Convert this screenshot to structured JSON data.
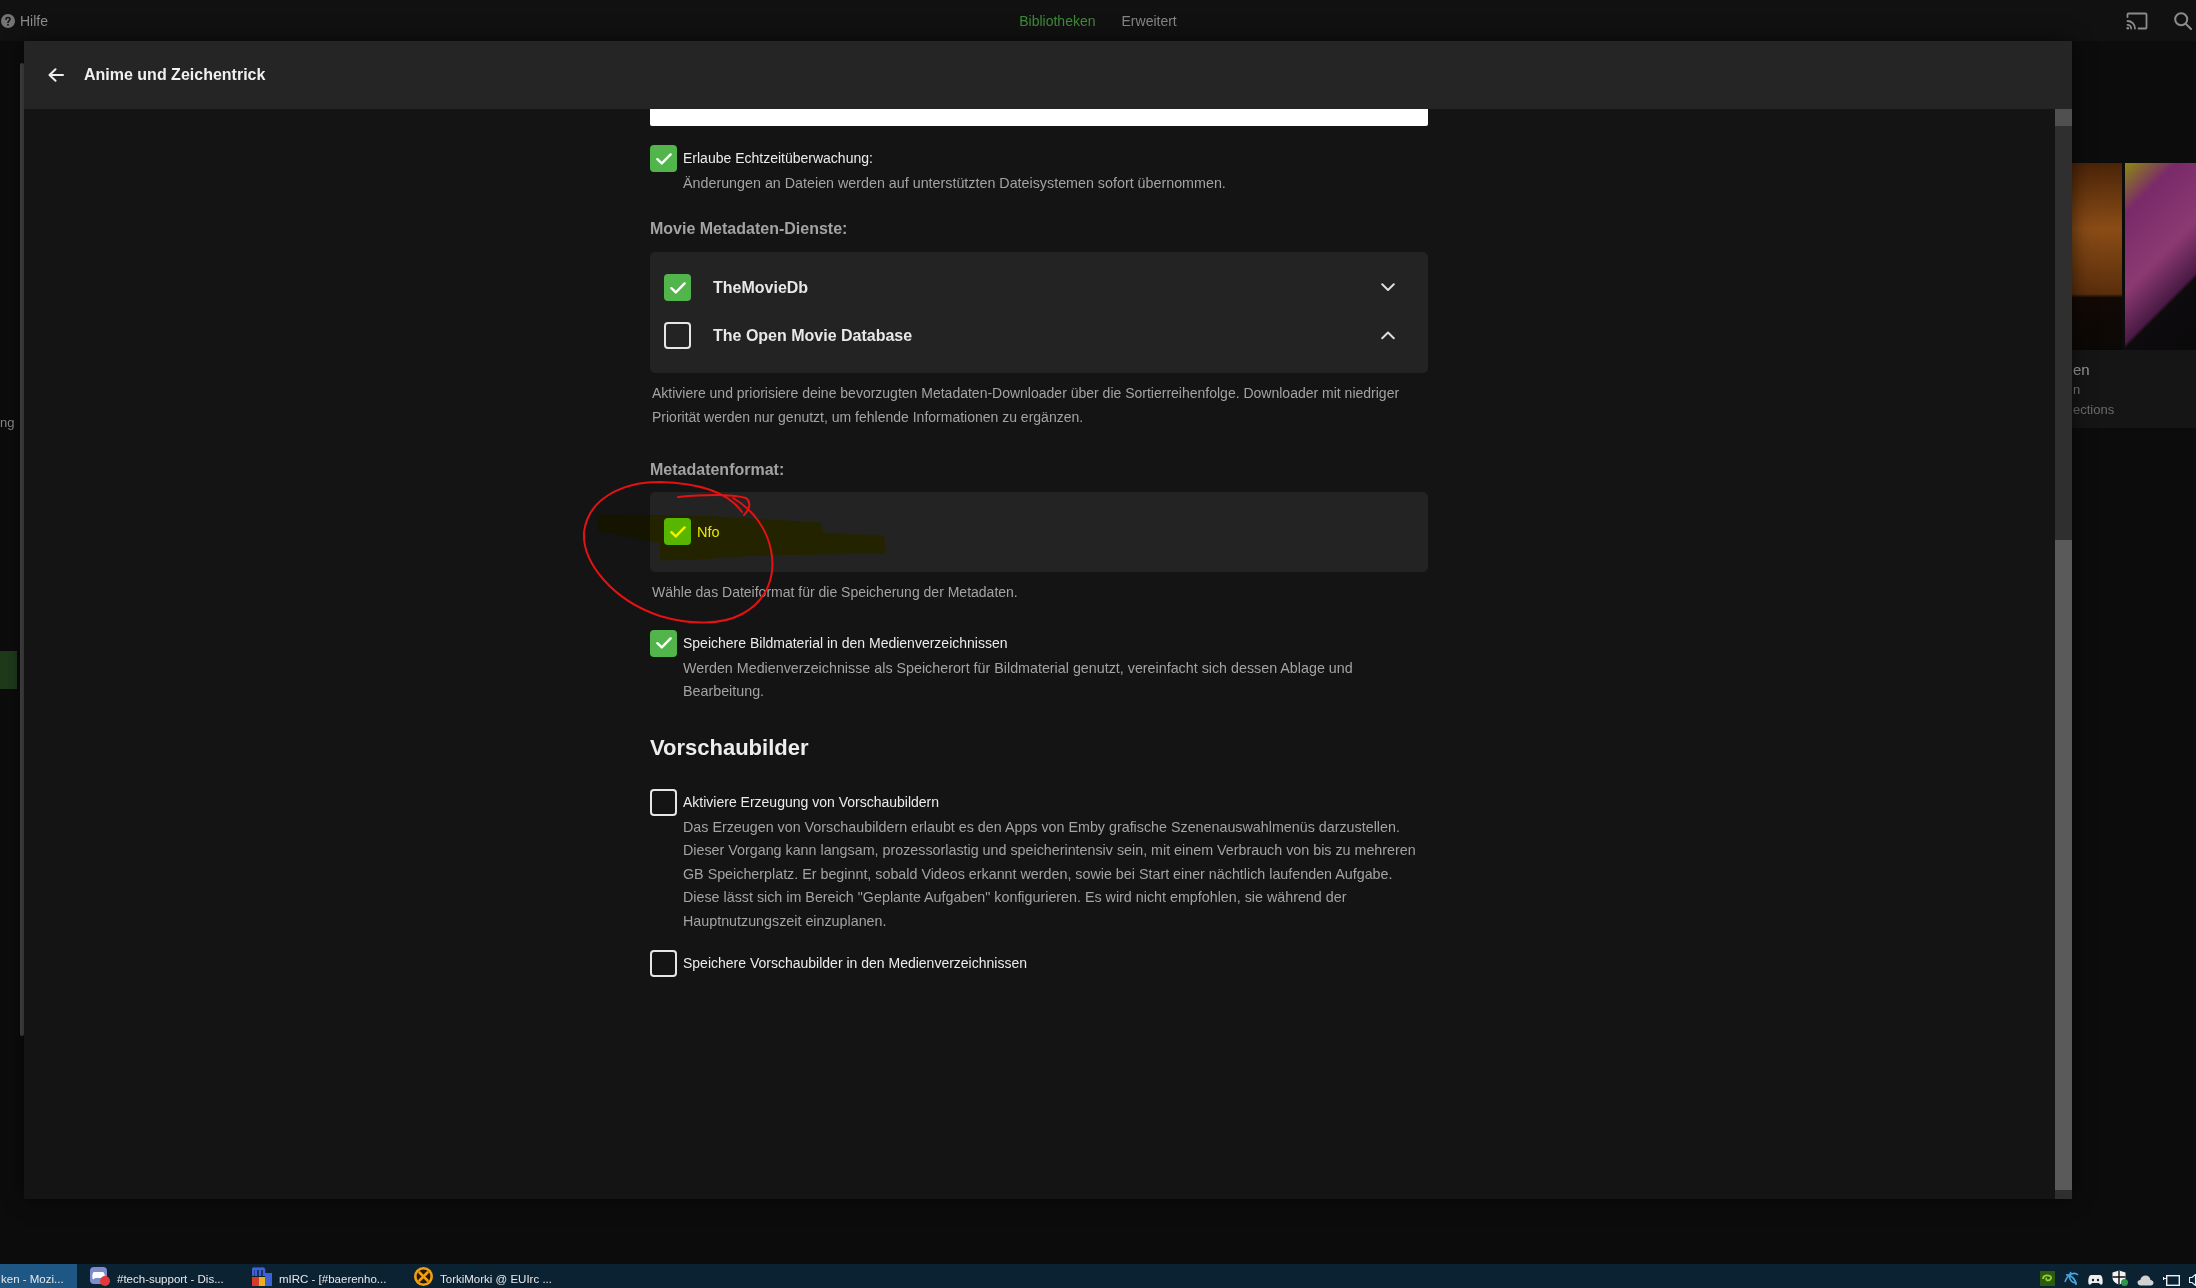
{
  "app_bar": {
    "help": "Hilfe",
    "tabs": [
      {
        "label": "Bibliotheken",
        "selected": true
      },
      {
        "label": "Erweitert",
        "selected": false
      }
    ]
  },
  "background_page": {
    "nav_items": [
      {
        "text": "ng",
        "selected": false
      },
      {
        "selected": true
      }
    ],
    "library_card_lines": [
      "en",
      "n",
      "ections"
    ]
  },
  "dialog": {
    "title": "Anime und Zeichentrick",
    "realtime_monitoring": {
      "label": "Erlaube Echtzeitüberwachung:",
      "description": "Änderungen an Dateien werden auf unterstützten Dateisystemen sofort übernommen.",
      "checked": true
    },
    "metadata_services": {
      "heading": "Movie Metadaten-Dienste:",
      "items": [
        {
          "name": "TheMovieDb",
          "checked": true,
          "kind": "down"
        },
        {
          "name": "The Open Movie Database",
          "checked": false,
          "kind": "up"
        }
      ],
      "description": "Aktiviere und priorisiere deine bevorzugten Metadaten-Downloader über die Sortierreihenfolge. Downloader mit niedriger Priorität werden nur genutzt, um fehlende Informationen zu ergänzen."
    },
    "metadata_format": {
      "heading": "Metadatenformat:",
      "options": [
        {
          "label": "Nfo",
          "checked": true,
          "highlighted": true
        }
      ],
      "description": "Wähle das Dateiformat für die Speicherung der Metadaten."
    },
    "save_artwork": {
      "label": "Speichere Bildmaterial in den Medienverzeichnissen",
      "description": "Werden Medienverzeichnisse als Speicherort für Bildmaterial genutzt, vereinfacht sich dessen Ablage und Bearbeitung.",
      "checked": true
    },
    "thumbnails": {
      "heading": "Vorschaubilder",
      "options": [
        {
          "label": "Aktiviere Erzeugung von Vorschaubildern",
          "description": "Das Erzeugen von Vorschaubildern erlaubt es den Apps von Emby grafische Szenenauswahlmenüs darzustellen. Dieser Vorgang kann langsam, prozessorlastig und speicherintensiv sein, mit einem Verbrauch von bis zu mehreren GB Speicherplatz. Er beginnt, sobald Videos erkannt werden, sowie bei Start einer nächtlich laufenden Aufgabe. Diese lässt sich im Bereich \"Geplante Aufgaben\" konfigurieren. Es wird nicht empfohlen, sie während der Hauptnutzungszeit einzuplanen.",
          "checked": false
        },
        {
          "label": "Speichere Vorschaubilder in den Medienverzeichnissen",
          "checked": false
        }
      ]
    }
  },
  "taskbar": {
    "items": [
      {
        "label": "ken - Mozi...",
        "selected": true
      },
      {
        "label": "#tech-support - Dis...",
        "selected": false
      },
      {
        "label": "mIRC - [#baerenho...",
        "selected": false
      },
      {
        "label": "TorkiMorki @ EUIrc ...",
        "selected": false
      }
    ]
  }
}
